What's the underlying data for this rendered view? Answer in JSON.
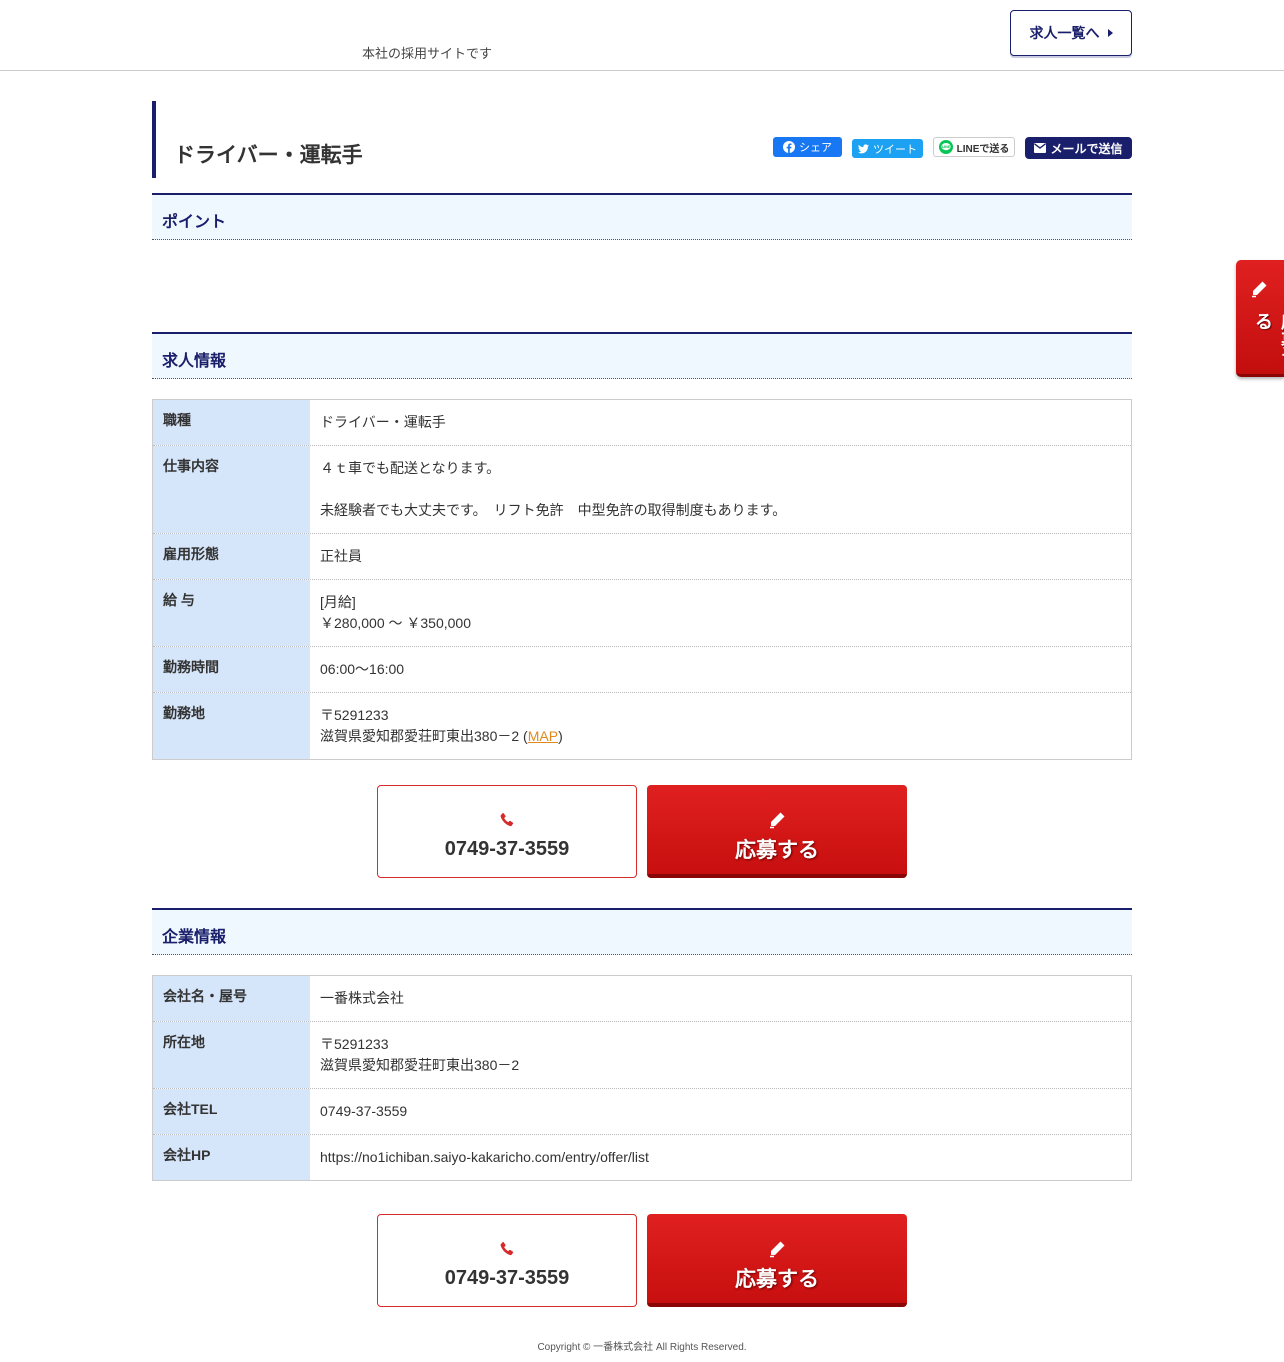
{
  "header": {
    "tagline": "本社の採用サイトです",
    "list_button": "求人一覧へ"
  },
  "job": {
    "title": "ドライバー・運転手"
  },
  "share": {
    "facebook": "シェア",
    "twitter": "ツイート",
    "line": "LINEで送る",
    "mail": "メールで送信"
  },
  "sections": {
    "point": "ポイント",
    "job_info": "求人情報",
    "company_info": "企業情報"
  },
  "job_info": {
    "type_label": "職種",
    "type_value": "ドライバー・運転手",
    "work_label": "仕事内容",
    "work_line1": "４ｔ車でも配送となります。",
    "work_line2": "未経験者でも大丈夫です。　リフト免許　中型免許の取得制度もあります。",
    "employment_label": "雇用形態",
    "employment_value": "正社員",
    "salary_label": "給 与",
    "salary_line1": "[月給]",
    "salary_line2": "￥280,000 ～ ￥350,000",
    "hours_label": "勤務時間",
    "hours_value": "06:00～16:00",
    "location_label": "勤務地",
    "location_zip": "〒5291233",
    "location_address": "滋賀県愛知郡愛荘町東出380－2",
    "map_open": " (",
    "map_link": "MAP",
    "map_close": ")"
  },
  "company": {
    "name_label": "会社名・屋号",
    "name_value": "一番株式会社",
    "address_label": "所在地",
    "address_zip": "〒5291233",
    "address_value": "滋賀県愛知郡愛荘町東出380－2",
    "tel_label": "会社TEL",
    "tel_value": "0749-37-3559",
    "hp_label": "会社HP",
    "hp_value": "https://no1ichiban.saiyo-kakaricho.com/entry/offer/list"
  },
  "actions": {
    "phone": "0749-37-3559",
    "apply": "応募する"
  },
  "side_tab": {
    "apply": "応募する"
  },
  "footer": {
    "copyright": "Copyright © 一番株式会社 All Rights Reserved."
  },
  "colors": {
    "navy": "#1a1f6b",
    "red": "#d01414",
    "th_bg": "#d6e6fa",
    "section_bg": "#f0f8ff"
  }
}
